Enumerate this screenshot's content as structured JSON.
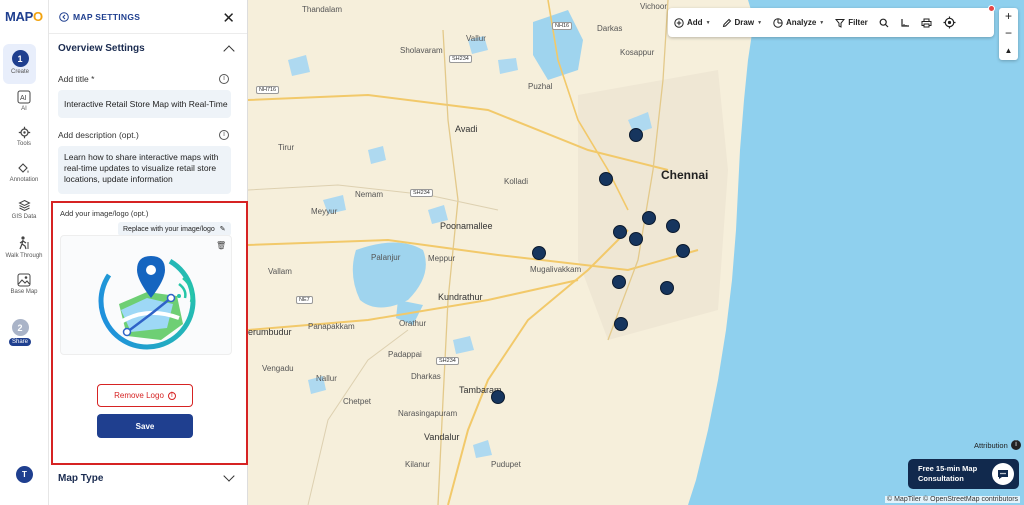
{
  "brand": {
    "logo_main": "MAP",
    "logo_tail": "O"
  },
  "rail": {
    "items": [
      {
        "label": "Create",
        "step": "1"
      },
      {
        "label": "AI"
      },
      {
        "label": "Tools"
      },
      {
        "label": "Annotation"
      },
      {
        "label": "GIS Data"
      },
      {
        "label": "Walk Through"
      },
      {
        "label": "Base Map"
      },
      {
        "label": "Share",
        "step": "2"
      }
    ],
    "avatar_initial": "T"
  },
  "panel": {
    "title": "MAP SETTINGS",
    "overview_title": "Overview Settings",
    "title_label": "Add title *",
    "title_value": "Interactive Retail Store Map with Real-Time",
    "desc_label": "Add description (opt.)",
    "desc_value": "Learn how to share interactive maps with real-time updates to visualize retail store locations, update information",
    "image_label": "Add your image/logo (opt.)",
    "replace_label": "Replace with your image/logo",
    "remove_label": "Remove Logo",
    "save_label": "Save",
    "map_type_title": "Map Type"
  },
  "toolbar": {
    "add": "Add",
    "draw": "Draw",
    "analyze": "Analyze",
    "filter": "Filter"
  },
  "map": {
    "labels": {
      "avadi": "Avadi",
      "chennai": "Chennai",
      "poonamallee": "Poonamallee",
      "kundrathur": "Kundrathur",
      "tambaram": "Tambaram",
      "vandalur": "Vandalur",
      "sriperumbudur": "erumbudur",
      "tiruvottiyur": "",
      "darkas": "Darkas",
      "kosappur": "Kosappur",
      "vichoor": "Vichoor",
      "puzhal": "Puzhal",
      "tirur": "Tirur",
      "kolladi": "Kolladi",
      "nemam": "Nemam",
      "meyyur": "Meyyur",
      "palanjur": "Palanjur",
      "meppur": "Meppur",
      "mugalivakkam": "Mugalivakkam",
      "vallam": "Vallam",
      "orathur": "Orathur",
      "chetpet": "Chetpet",
      "dharkas": "Dharkas",
      "padappai": "Padappai",
      "vengadu": "Vengadu",
      "panapakkam": "Panapakkam",
      "nallur": "Nallur",
      "narasingapuram": "Narasingapuram",
      "kilanur": "Kilanur",
      "pudupet": "Pudupet",
      "vallur": "Vallur",
      "sholavaram": "Sholavaram",
      "thandalam": "Thandalam"
    },
    "shields": {
      "sh234_a": "SH234",
      "sh234_b": "SH234",
      "sh234_c": "SH234",
      "nh716": "NH716",
      "nh16": "NH16",
      "ne7": "NE7"
    },
    "attribution": "Attribution",
    "credit": "© MapTiler © OpenStreetMap contributors",
    "consult": "Free 15-min Map Consultation"
  },
  "colors": {
    "brand_blue": "#1f3f8f",
    "accent_red": "#d62323",
    "sea": "#8fd0ee",
    "land": "#f7f0dd",
    "marker": "#16355e"
  }
}
